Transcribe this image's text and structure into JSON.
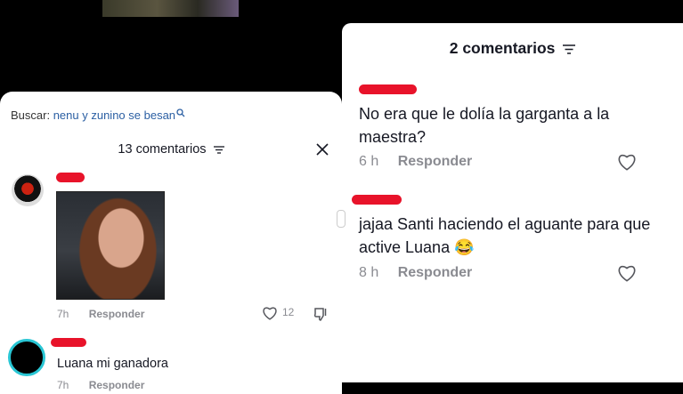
{
  "left_panel": {
    "search_label": "Buscar:",
    "search_query": "nenu y zunino se besan",
    "header": "13 comentarios",
    "comment1": {
      "time": "7h",
      "reply": "Responder",
      "likes": "12"
    },
    "comment2": {
      "text": "Luana mi ganadora",
      "time": "7h",
      "reply": "Responder"
    }
  },
  "right_panel": {
    "header": "2 comentarios",
    "comments": [
      {
        "text": "No era que le dolía la garganta a la maestra?",
        "time": "6 h",
        "reply": "Responder"
      },
      {
        "text": "jajaa Santi haciendo el aguante para que active Luana 😂",
        "time": "8 h",
        "reply": "Responder"
      }
    ]
  },
  "colors": {
    "accent_link": "#2b5fa3",
    "redaction": "#e8132a",
    "avatar_ring": "#29c6d4"
  }
}
